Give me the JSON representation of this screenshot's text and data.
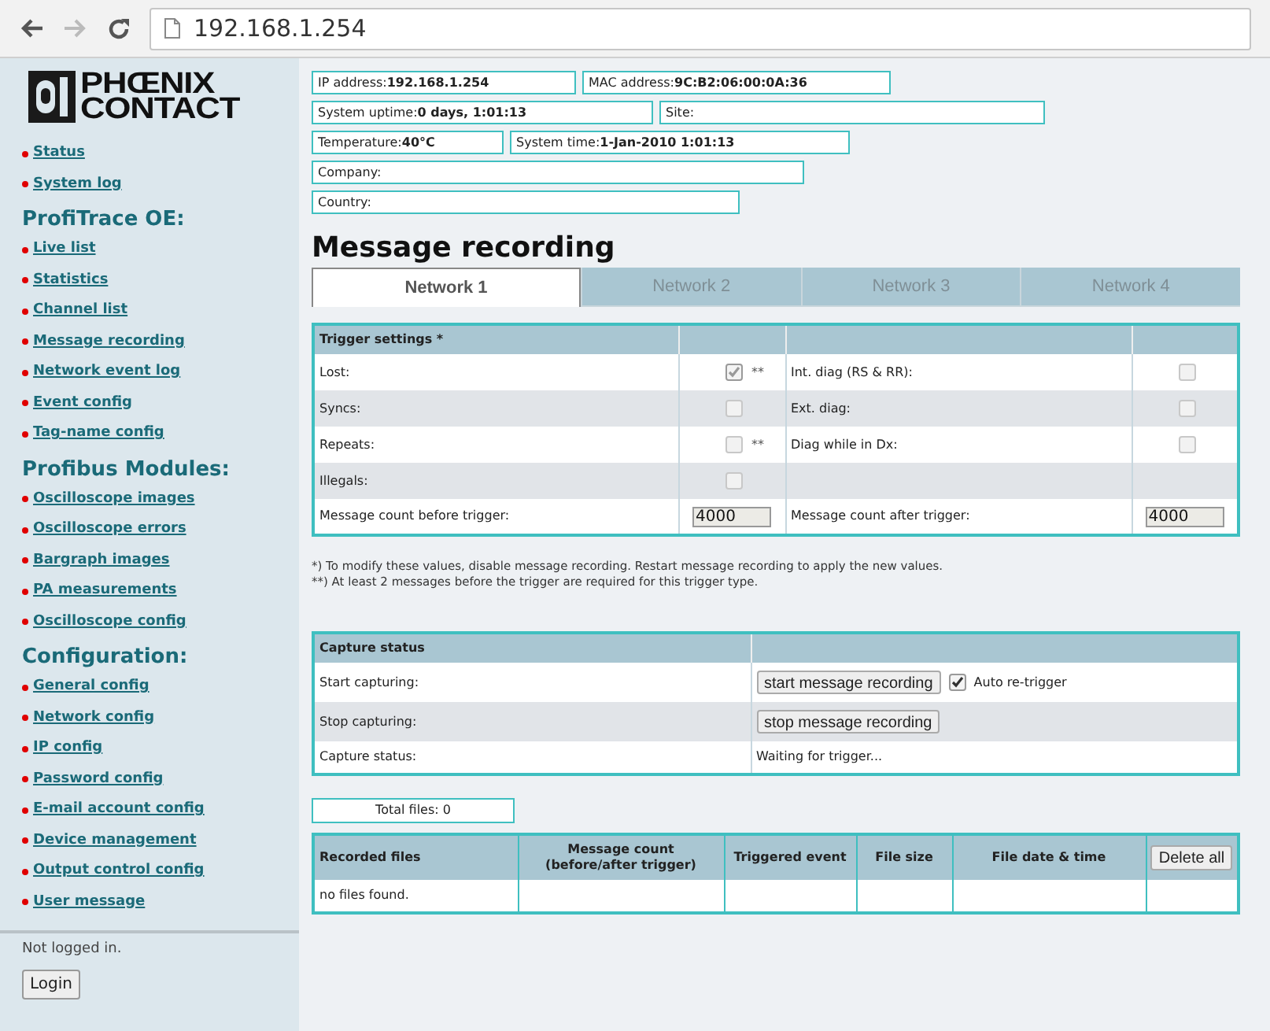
{
  "browser": {
    "url": "192.168.1.254"
  },
  "sidebar": {
    "logo": [
      "PHŒNIX",
      "CONTACT"
    ],
    "sections": [
      {
        "links": [
          "Status",
          "System log"
        ]
      },
      {
        "heading": "ProfiTrace OE:",
        "links": [
          "Live list",
          "Statistics",
          "Channel list",
          "Message recording",
          "Network event log",
          "Event config",
          "Tag-name config"
        ]
      },
      {
        "heading": "Profibus Modules:",
        "links": [
          "Oscilloscope images",
          "Oscilloscope errors",
          "Bargraph images",
          "PA measurements",
          "Oscilloscope config"
        ]
      },
      {
        "heading": "Configuration:",
        "links": [
          "General config",
          "Network config",
          "IP config",
          "Password config",
          "E-mail account config",
          "Device management",
          "Output control config",
          "User message"
        ]
      }
    ],
    "login_status": "Not logged in.",
    "login_button": "Login"
  },
  "info": [
    [
      {
        "label": "IP address:",
        "value": "192.168.1.254"
      },
      {
        "label": "MAC address:",
        "value": "9C:B2:06:00:0A:36"
      }
    ],
    [
      {
        "label": "System uptime:",
        "value": "0 days, 1:01:13"
      },
      {
        "label": "Site:"
      }
    ],
    [
      {
        "label": "Temperature:",
        "value": "40°C"
      },
      {
        "label": "System time:",
        "value": "1-Jan-2010 1:01:13"
      }
    ],
    [
      {
        "label": "Company:"
      }
    ],
    [
      {
        "label": "Country:"
      }
    ]
  ],
  "title": "Message recording",
  "tabs": [
    {
      "label": "Network 1",
      "selected": true
    },
    {
      "label": "Network 2",
      "selected": false
    },
    {
      "label": "Network 3",
      "selected": false
    },
    {
      "label": "Network 4",
      "selected": false
    }
  ],
  "trigger_settings": {
    "heading": "Trigger settings *",
    "rows": [
      {
        "kind": "check",
        "left": {
          "label": "Lost:",
          "checked": true,
          "note": "**"
        },
        "right": {
          "label": "Int. diag (RS & RR):",
          "checked": false
        }
      },
      {
        "kind": "check",
        "left": {
          "label": "Syncs:",
          "checked": false
        },
        "right": {
          "label": "Ext. diag:",
          "checked": false
        }
      },
      {
        "kind": "check",
        "left": {
          "label": "Repeats:",
          "checked": false,
          "note": "**"
        },
        "right": {
          "label": "Diag while in Dx:",
          "checked": false
        }
      },
      {
        "kind": "check",
        "left": {
          "label": "Illegals:",
          "checked": false
        }
      },
      {
        "kind": "count",
        "left": {
          "label": "Message count before trigger:",
          "value": "4000"
        },
        "right": {
          "label": "Message count after trigger:",
          "value": "4000"
        }
      }
    ]
  },
  "notes": [
    "*) To modify these values, disable message recording. Restart message recording to apply the new values.",
    "**) At least 2 messages before the trigger are required for this trigger type."
  ],
  "capture": {
    "heading": "Capture status",
    "rows": [
      {
        "kind": "button",
        "label": "Start capturing:",
        "button": "start message recording",
        "option": {
          "label": "Auto re-trigger",
          "checked": true
        }
      },
      {
        "kind": "button",
        "label": "Stop capturing:",
        "button": "stop message recording"
      },
      {
        "kind": "text",
        "label": "Capture status:",
        "value": "Waiting for trigger..."
      }
    ]
  },
  "total_files": "Total files: 0",
  "files": {
    "columns": [
      "Recorded files",
      "Message count\n(before/after trigger)",
      "Triggered event",
      "File size",
      "File date & time"
    ],
    "delete_button": "Delete all",
    "empty": "no files found."
  }
}
